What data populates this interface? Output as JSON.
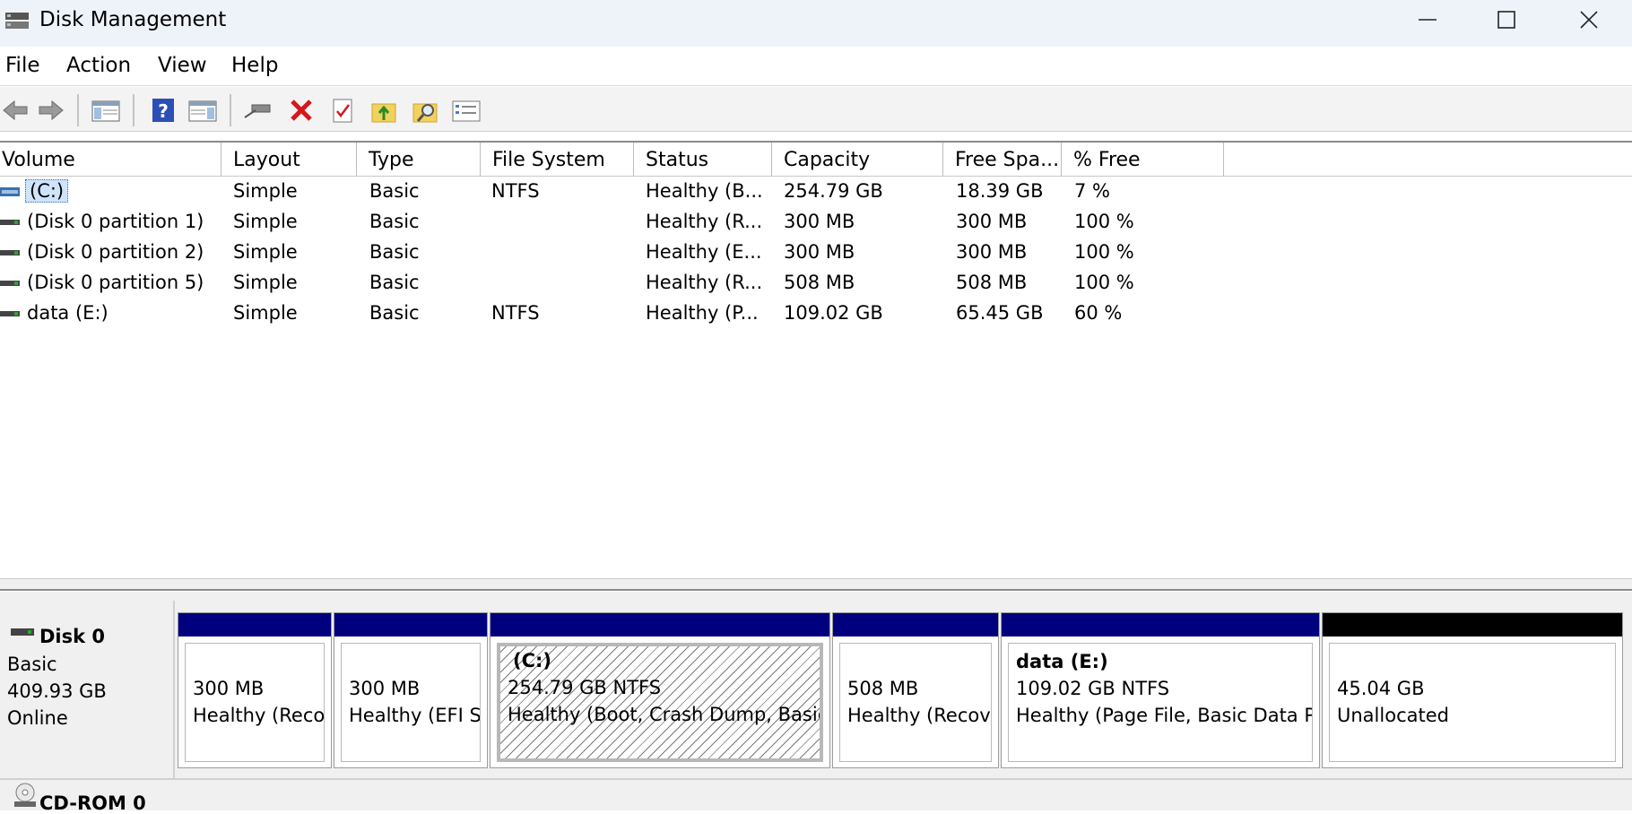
{
  "window": {
    "title": "Disk Management",
    "controls": [
      "minimize",
      "maximize",
      "close"
    ]
  },
  "menu": [
    "File",
    "Action",
    "View",
    "Help"
  ],
  "toolbar": {
    "buttons": [
      "back-icon",
      "forward-icon",
      "show-hide-console-tree-icon",
      "help-icon",
      "show-action-pane-icon",
      "connect-drive-icon",
      "delete-icon",
      "properties-icon",
      "open-folder-icon",
      "explore-icon",
      "properties-list-icon"
    ]
  },
  "volume_table": {
    "columns": [
      "Volume",
      "Layout",
      "Type",
      "File System",
      "Status",
      "Capacity",
      "Free Spa...",
      "% Free"
    ],
    "rows": [
      {
        "volume": "(C:)",
        "layout": "Simple",
        "type": "Basic",
        "fs": "NTFS",
        "status": "Healthy (B...",
        "capacity": "254.79 GB",
        "free": "18.39 GB",
        "pct": "7 %",
        "selected": true
      },
      {
        "volume": "(Disk 0 partition 1)",
        "layout": "Simple",
        "type": "Basic",
        "fs": "",
        "status": "Healthy (R...",
        "capacity": "300 MB",
        "free": "300 MB",
        "pct": "100 %"
      },
      {
        "volume": "(Disk 0 partition 2)",
        "layout": "Simple",
        "type": "Basic",
        "fs": "",
        "status": "Healthy (E...",
        "capacity": "300 MB",
        "free": "300 MB",
        "pct": "100 %"
      },
      {
        "volume": "(Disk 0 partition 5)",
        "layout": "Simple",
        "type": "Basic",
        "fs": "",
        "status": "Healthy (R...",
        "capacity": "508 MB",
        "free": "508 MB",
        "pct": "100 %"
      },
      {
        "volume": "data (E:)",
        "layout": "Simple",
        "type": "Basic",
        "fs": "NTFS",
        "status": "Healthy (P...",
        "capacity": "109.02 GB",
        "free": "65.45 GB",
        "pct": "60 %"
      }
    ]
  },
  "disk0": {
    "name": "Disk 0",
    "type": "Basic",
    "size": "409.93 GB",
    "state": "Online",
    "partitions": [
      {
        "title": "",
        "line1": "300 MB",
        "line2": "Healthy (Reco"
      },
      {
        "title": "",
        "line1": "300 MB",
        "line2": "Healthy (EFI S"
      },
      {
        "title": "(C:)",
        "line1": "254.79 GB NTFS",
        "line2": "Healthy (Boot, Crash Dump, Basic"
      },
      {
        "title": "",
        "line1": "508 MB",
        "line2": "Healthy (Recov"
      },
      {
        "title": "data  (E:)",
        "line1": "109.02 GB NTFS",
        "line2": "Healthy (Page File, Basic Data P"
      },
      {
        "title": "",
        "line1": "45.04 GB",
        "line2": "Unallocated"
      }
    ]
  },
  "cdrom": {
    "name": "CD-ROM 0"
  }
}
